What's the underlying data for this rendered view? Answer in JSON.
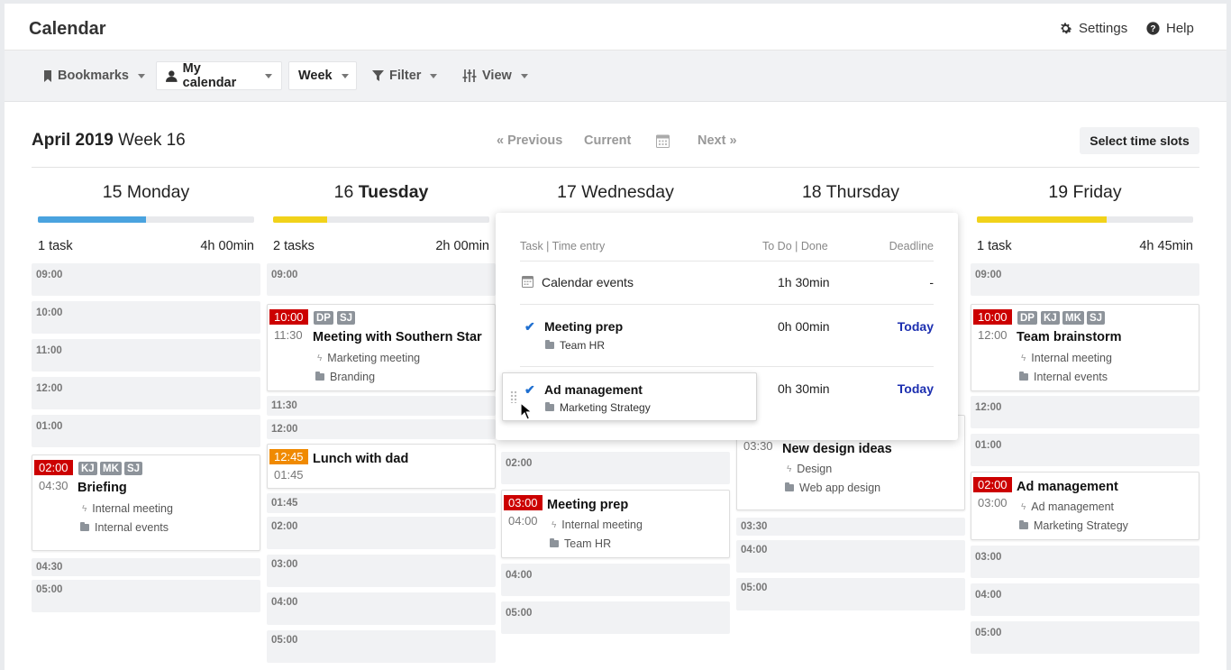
{
  "app": {
    "title": "Calendar"
  },
  "top_actions": {
    "settings": "Settings",
    "help": "Help"
  },
  "toolbar": {
    "bookmarks": "Bookmarks",
    "my_calendar": "My calendar",
    "week": "Week",
    "filter": "Filter",
    "view": "View"
  },
  "period": {
    "month_year": "April 2019",
    "week": "Week 16"
  },
  "nav": {
    "previous": "« Previous",
    "current": "Current",
    "next": "Next »"
  },
  "select_slots": "Select time slots",
  "days": [
    {
      "num": "15",
      "name": "Monday",
      "tasks": "1 task",
      "total": "4h 00min",
      "bar_color": "#4aa3df",
      "bar_fill": 0.5
    },
    {
      "num": "16",
      "name": "Tuesday",
      "tasks": "2 tasks",
      "total": "2h 00min",
      "bar_color": "#f1d21a",
      "bar_fill": 0.25
    },
    {
      "num": "17",
      "name": "Wednesday",
      "tasks": "",
      "total": "",
      "bar_color": "#e8e9ec",
      "bar_fill": 0
    },
    {
      "num": "18",
      "name": "Thursday",
      "tasks": "",
      "total": "",
      "bar_color": "#e8e9ec",
      "bar_fill": 0
    },
    {
      "num": "19",
      "name": "Friday",
      "tasks": "1 task",
      "total": "4h 45min",
      "bar_color": "#f1d21a",
      "bar_fill": 0.6
    }
  ],
  "mon": {
    "slots": [
      "09:00",
      "10:00",
      "11:00",
      "12:00",
      "01:00",
      "04:30",
      "05:00"
    ],
    "briefing": {
      "start": "02:00",
      "end": "04:30",
      "title": "Briefing",
      "initials": [
        "KJ",
        "MK",
        "SJ"
      ],
      "activity": "Internal meeting",
      "project": "Internal events"
    }
  },
  "tue": {
    "slots": [
      "09:00",
      "11:30",
      "12:00",
      "01:45",
      "02:00",
      "03:00",
      "04:00",
      "05:00"
    ],
    "southern": {
      "start": "10:00",
      "end": "11:30",
      "title": "Meeting with Southern Star",
      "initials": [
        "DP",
        "SJ"
      ],
      "activity": "Marketing meeting",
      "project": "Branding"
    },
    "lunch": {
      "start": "12:45",
      "end": "01:45",
      "title": "Lunch with dad"
    }
  },
  "wed": {
    "slots": [
      "02:00",
      "04:00",
      "05:00"
    ],
    "prep": {
      "start": "03:00",
      "end": "04:00",
      "title": "Meeting prep",
      "activity": "Internal meeting",
      "project": "Team HR"
    }
  },
  "thu": {
    "slots": [
      "03:30",
      "04:00",
      "05:00"
    ],
    "design": {
      "end": "03:30",
      "title": "New design ideas",
      "activity": "Design",
      "project": "Web app design"
    }
  },
  "fri": {
    "slots": [
      "09:00",
      "12:00",
      "01:00",
      "03:00",
      "04:00",
      "05:00"
    ],
    "brainstorm": {
      "start": "10:00",
      "end": "12:00",
      "title": "Team brainstorm",
      "initials": [
        "DP",
        "KJ",
        "MK",
        "SJ"
      ],
      "activity": "Internal meeting",
      "project": "Internal events"
    },
    "ad": {
      "start": "02:00",
      "end": "03:00",
      "title": "Ad management",
      "activity": "Ad management",
      "project": "Marketing Strategy"
    }
  },
  "popup": {
    "col_task": "Task | Time entry",
    "col_todo": "To Do | Done",
    "col_deadline": "Deadline",
    "calendar_events": {
      "label": "Calendar events",
      "time": "1h 30min",
      "deadline": "-"
    },
    "items": [
      {
        "title": "Meeting prep",
        "project": "Team HR",
        "time": "0h 00min",
        "deadline": "Today"
      },
      {
        "title": "Ad management",
        "project": "Marketing Strategy",
        "time": "0h 30min",
        "deadline": "Today"
      }
    ]
  }
}
